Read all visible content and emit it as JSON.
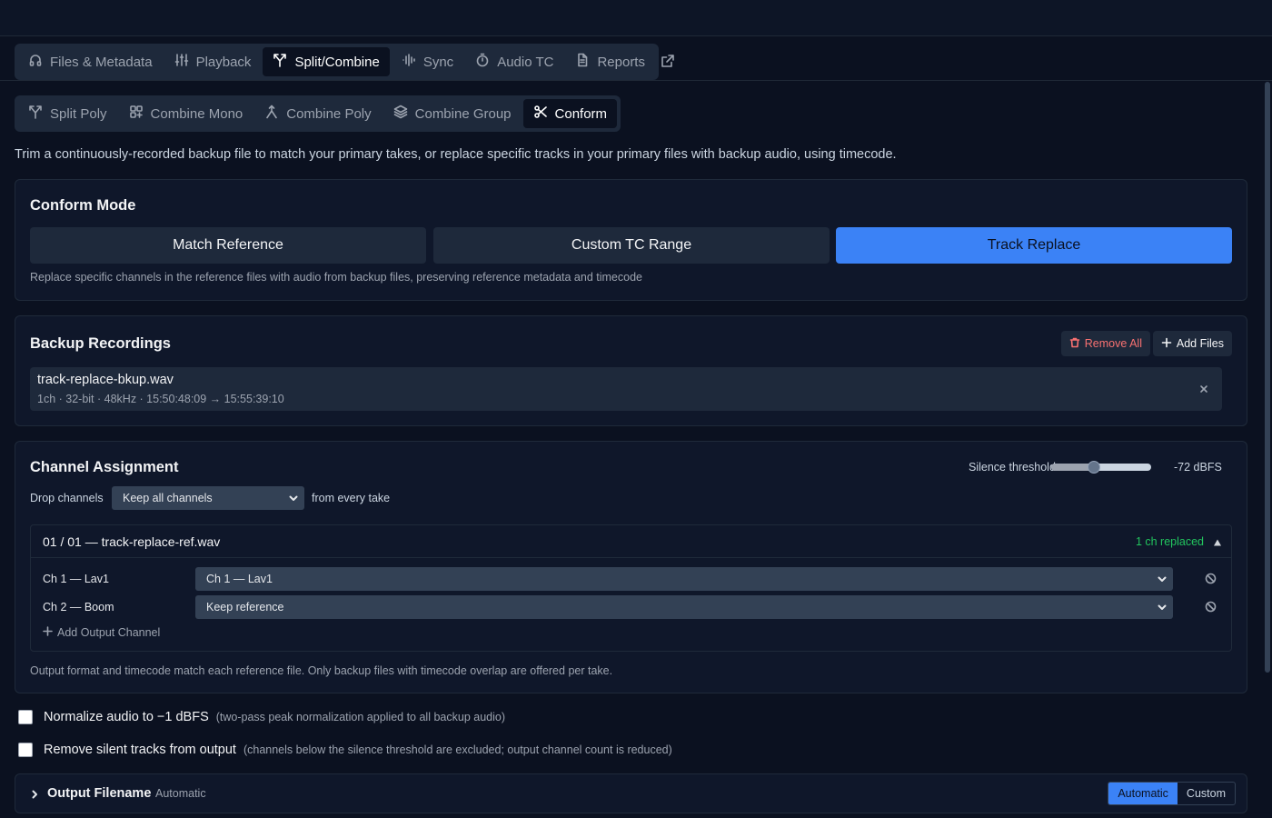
{
  "main_tabs": [
    {
      "label": "Files & Metadata",
      "icon": "headphones-icon"
    },
    {
      "label": "Playback",
      "icon": "sliders-icon"
    },
    {
      "label": "Split/Combine",
      "icon": "split-icon",
      "active": true
    },
    {
      "label": "Sync",
      "icon": "waveform-icon"
    },
    {
      "label": "Audio TC",
      "icon": "stopwatch-icon"
    },
    {
      "label": "Reports",
      "icon": "document-icon"
    }
  ],
  "sub_tabs": [
    {
      "label": "Split Poly",
      "icon": "split-icon"
    },
    {
      "label": "Combine Mono",
      "icon": "combine-mono-icon"
    },
    {
      "label": "Combine Poly",
      "icon": "merge-icon"
    },
    {
      "label": "Combine Group",
      "icon": "layers-icon"
    },
    {
      "label": "Conform",
      "icon": "scissors-icon",
      "active": true
    }
  ],
  "description": "Trim a continuously-recorded backup file to match your primary takes, or replace specific tracks in your primary files with backup audio, using timecode.",
  "conform_mode": {
    "title": "Conform Mode",
    "options": [
      "Match Reference",
      "Custom TC Range",
      "Track Replace"
    ],
    "selected": "Track Replace",
    "hint": "Replace specific channels in the reference files with audio from backup files, preserving reference metadata and timecode"
  },
  "backup": {
    "title": "Backup Recordings",
    "remove_all": "Remove All",
    "add_files": "Add Files",
    "files": [
      {
        "name": "track-replace-bkup.wav",
        "meta": "1ch · 32-bit · 48kHz · 15:50:48:09 → 15:55:39:10"
      }
    ]
  },
  "channels": {
    "title": "Channel Assignment",
    "silence_label": "Silence threshold",
    "silence_value": "-72 dBFS",
    "silence_fraction": 0.43,
    "drop_label": "Drop channels",
    "drop_value": "Keep all channels",
    "drop_suffix": "from every take",
    "take": {
      "title": "01 / 01 — track-replace-ref.wav",
      "badge": "1 ch replaced",
      "rows": [
        {
          "label": "Ch 1 — Lav1",
          "value": "Ch 1 — Lav1"
        },
        {
          "label": "Ch 2 — Boom",
          "value": "Keep reference"
        }
      ],
      "add_label": "Add Output Channel"
    },
    "footnote": "Output format and timecode match each reference file. Only backup files with timecode overlap are offered per take."
  },
  "options": [
    {
      "label": "Normalize audio to −1 dBFS",
      "hint": "(two-pass peak normalization applied to all backup audio)",
      "checked": false
    },
    {
      "label": "Remove silent tracks from output",
      "hint": "(channels below the silence threshold are excluded; output channel count is reduced)",
      "checked": false
    }
  ],
  "output_filename": {
    "title": "Output Filename",
    "subtitle": "Automatic",
    "modes": [
      "Automatic",
      "Custom"
    ],
    "selected": "Automatic"
  },
  "colors": {
    "accent": "#3b82f6",
    "success": "#22c55e",
    "danger": "#f87171",
    "background": "#0b1120",
    "panel": "#0f172a"
  }
}
